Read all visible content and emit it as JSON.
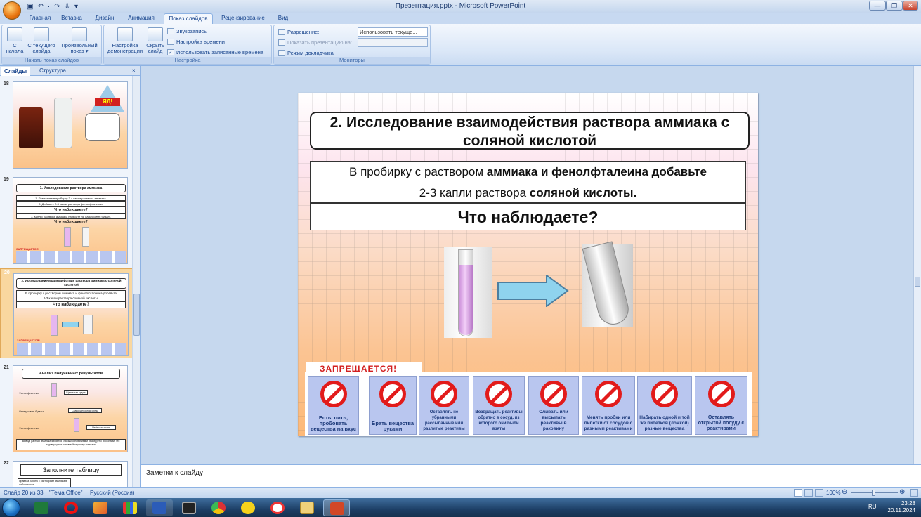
{
  "window": {
    "title": "Презентация.pptx - Microsoft PowerPoint"
  },
  "qat": [
    "▣",
    "↶",
    "·",
    "↷",
    "⇩",
    "▾"
  ],
  "tabs": [
    "Главная",
    "Вставка",
    "Дизайн",
    "Анимация",
    "Показ слайдов",
    "Рецензирование",
    "Вид"
  ],
  "active_tab": "Показ слайдов",
  "ribbon": {
    "groups": {
      "start": "Начать показ слайдов",
      "setup": "Настройка",
      "monitors": "Мониторы"
    },
    "from_start": "С\nначала",
    "from_current": "С текущего\nслайда",
    "custom": "Произвольный\nпоказ ▾",
    "setup_show": "Настройка\nдемонстрации",
    "hide_slide": "Скрыть\nслайд",
    "record": "Звукозапись",
    "rehearse": "Настройка времени",
    "use_timings": "Использовать записанные времена",
    "resolution_label": "Разрешение:",
    "resolution_value": "Использовать текуще...",
    "show_on": "Показать презентацию на:",
    "presenter_view": "Режим докладчика"
  },
  "panel": {
    "tab_slides": "Слайды",
    "tab_outline": "Структура",
    "close": "×"
  },
  "thumbs": [
    {
      "num": "18",
      "badge": "ЯД!"
    },
    {
      "num": "19",
      "title": "1. Исследование раствора аммиака",
      "l1": "1. Поместите в пробирку 3-4 капли раствора аммиака.",
      "l2": "2. Добавьте 2-3 капли раствора фенолфталеина.",
      "q1": "Что наблюдаете?",
      "l3": "3. Каплю раствора аммиака нанесите на лакмусовую бумагу.",
      "q2": "Что наблюдаете?",
      "warn": "ЗАПРЕЩАЕТСЯ!"
    },
    {
      "num": "20",
      "title": "2. Исследование взаимодействия  раствора аммиака  с соляной кислотой",
      "l1": "В пробирку с раствором аммиака и фенолфталеина добавьте",
      "l2": "2-3 капли раствора соляной кислоты.",
      "q": "Что наблюдаете?",
      "warn": "ЗАПРЕЩАЕТСЯ!"
    },
    {
      "num": "21",
      "title": "Анализ полученных результатов",
      "r1": "Фенолфталеин",
      "r1b": "Щелочная среда",
      "r2": "Лакмусовая бумага",
      "r2b": "Слабо щелочная среда",
      "r3": "Фенолфталеин",
      "r3b": "Нейтрализация",
      "conc": "Вывод: раствор аммиака является слабым основанием и реагирует с кислотами, что подтверждает основный характер аммиака."
    },
    {
      "num": "22",
      "title": "Заполните таблицу",
      "cell": "Правила работы с растворами аммиака в лаборатории"
    }
  ],
  "slide": {
    "title": "2. Исследование  взаимодействия  раствора аммиака  с соляной кислотой",
    "task_a": "В пробирку с раствором ",
    "task_b": "аммиака и фенолфталеина добавьте",
    "task_c": "2-3 капли раствора ",
    "task_d": "соляной кислоты.",
    "question": "Что наблюдаете?",
    "warning": "ЗАПРЕЩАЕТСЯ!",
    "signs": [
      "Есть, пить, пробовать вещества на вкус",
      "Брать вещества руками",
      "Оставлять не убранными рассыпанные или разлитые реактивы",
      "Возвращать реактивы обратно в сосуд, из которого они были взяты",
      "Сливать или высыпать реактивы в раковину",
      "Менять пробки или пипетки от сосудов с разными реактивами",
      "Набирать одной и той же пипеткой (ложкой) разные вещества",
      "Оставлять открытой посуду с реактивами"
    ]
  },
  "notes": "Заметки к слайду",
  "status": {
    "slide": "Слайд 20 из 33",
    "theme": "\"Тема Office\"",
    "lang": "Русский (Россия)",
    "zoom": "100%"
  },
  "tray": {
    "lang": "RU",
    "time": "23:28",
    "date": "20.11.2024"
  },
  "colors": {
    "warning_red": "#d21f1f",
    "sign_bg": "#b9c6ef",
    "ribbon_blue": "#15428b"
  }
}
